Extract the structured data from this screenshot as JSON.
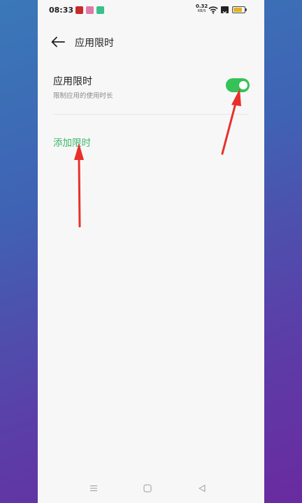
{
  "status_bar": {
    "time": "08:33",
    "notification_icons": [
      "news-app-icon",
      "chat-app-icon",
      "green-app-icon"
    ],
    "network_speed": "0.32",
    "network_speed_unit": "KB/S",
    "battery_level": 0.8,
    "battery_color": "#e3b21f"
  },
  "header": {
    "title": "应用限时"
  },
  "setting": {
    "title": "应用限时",
    "subtitle": "限制应用的使用时长",
    "enabled": true,
    "toggle_color": "#34c259"
  },
  "actions": {
    "add_limit_label": "添加限时",
    "accent_color": "#3cb86a"
  },
  "annotation": {
    "arrow_color": "#e8302a"
  },
  "navbar": {
    "icons": [
      "menu-icon",
      "home-icon",
      "back-triangle-icon"
    ]
  }
}
